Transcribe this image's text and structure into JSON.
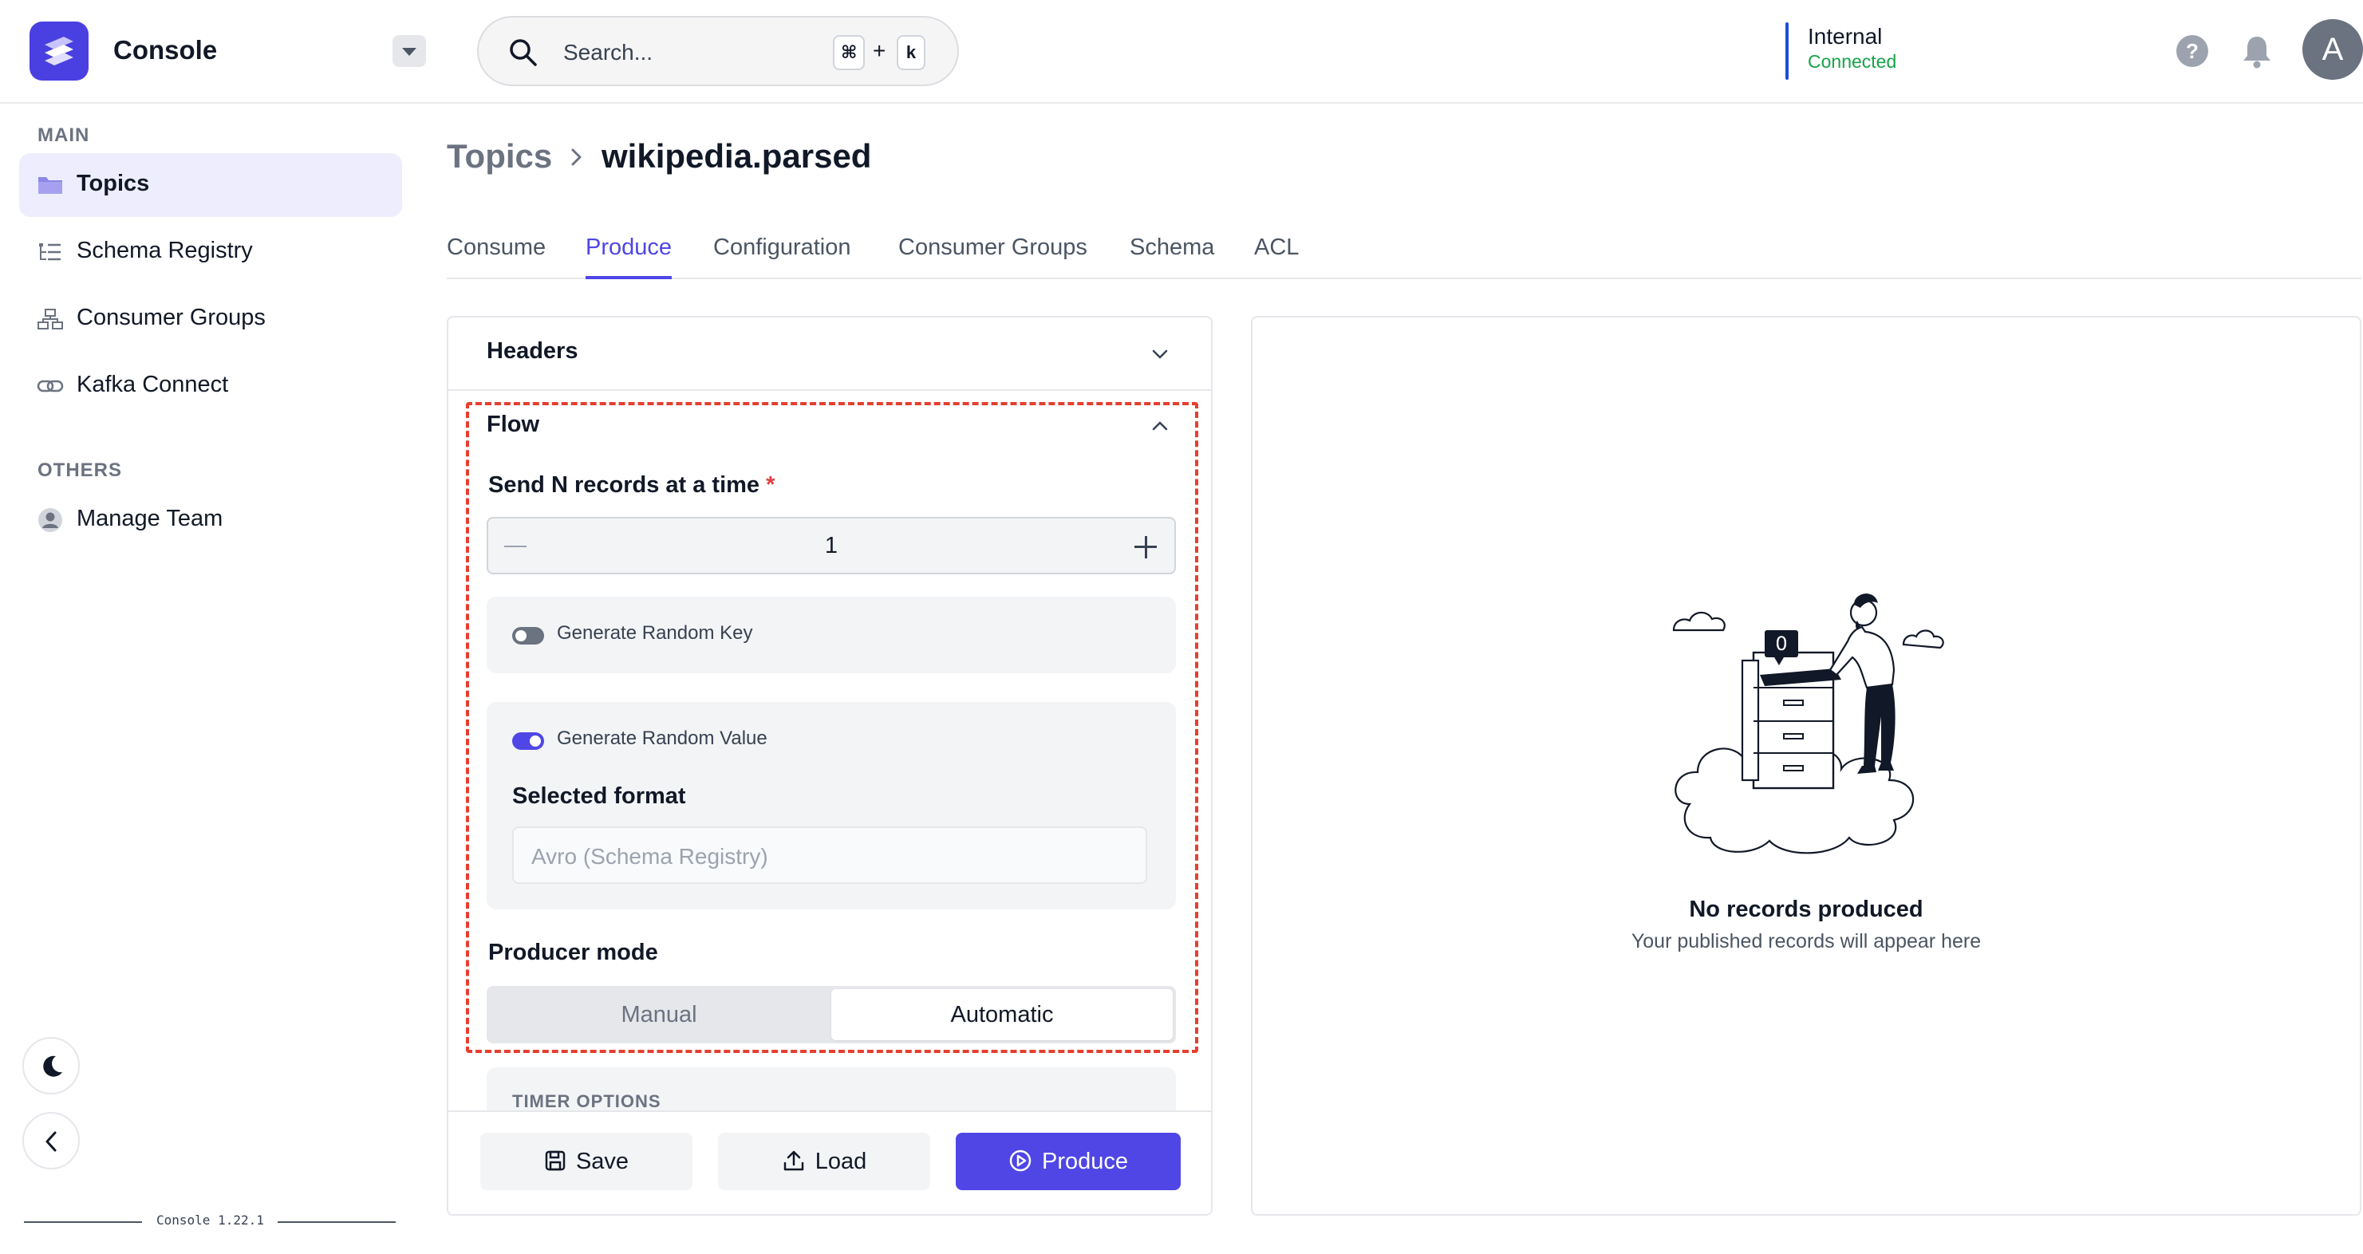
{
  "header": {
    "app_title": "Console",
    "search_placeholder": "Search...",
    "shortcut_cmd": "⌘",
    "shortcut_plus": "+",
    "shortcut_key": "k",
    "environment_name": "Internal",
    "environment_status": "Connected",
    "help_label": "?",
    "avatar_initial": "A"
  },
  "sidebar": {
    "main_heading": "MAIN",
    "main_items": [
      {
        "label": "Topics",
        "icon": "folder-icon",
        "active": true
      },
      {
        "label": "Schema Registry",
        "icon": "list-tree-icon",
        "active": false
      },
      {
        "label": "Consumer Groups",
        "icon": "hierarchy-icon",
        "active": false
      },
      {
        "label": "Kafka Connect",
        "icon": "link-icon",
        "active": false
      }
    ],
    "others_heading": "OTHERS",
    "other_items": [
      {
        "label": "Manage Team",
        "icon": "user-circle-icon",
        "active": false
      }
    ],
    "version": "Console 1.22.1"
  },
  "breadcrumb": {
    "root": "Topics",
    "current": "wikipedia.parsed"
  },
  "tabs": [
    {
      "label": "Consume",
      "active": false
    },
    {
      "label": "Produce",
      "active": true
    },
    {
      "label": "Configuration",
      "active": false
    },
    {
      "label": "Consumer Groups",
      "active": false
    },
    {
      "label": "Schema",
      "active": false
    },
    {
      "label": "ACL",
      "active": false
    }
  ],
  "produce_form": {
    "headers_title": "Headers",
    "flow_title": "Flow",
    "records_label": "Send N records at a time",
    "required_mark": "*",
    "records_value": "1",
    "random_key_label": "Generate Random Key",
    "random_key_enabled": false,
    "random_value_label": "Generate Random Value",
    "random_value_enabled": true,
    "selected_format_label": "Selected format",
    "selected_format_value": "Avro (Schema Registry)",
    "producer_mode_label": "Producer mode",
    "producer_mode_options": [
      "Manual",
      "Automatic"
    ],
    "producer_mode_selected": "Automatic",
    "timer_options_label": "TIMER OPTIONS",
    "save_label": "Save",
    "load_label": "Load",
    "produce_label": "Produce"
  },
  "results": {
    "empty_title": "No records produced",
    "empty_subtitle": "Your published records will appear here",
    "illustration_badge": "0"
  },
  "colors": {
    "accent": "#4f46e5",
    "logo": "#4a3fe0",
    "connected": "#16a34a",
    "highlight_border": "#e53e2f"
  }
}
